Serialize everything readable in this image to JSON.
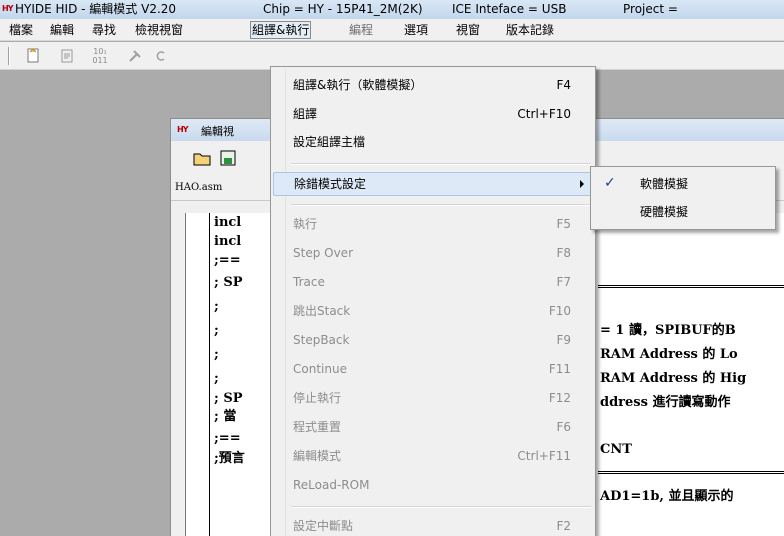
{
  "titlebar": {
    "app": "HYIDE HID - 編輯模式 V2.20",
    "chip": "Chip = HY - 15P41_2M(2K)",
    "ice": "ICE Inteface = USB",
    "project": "Project ="
  },
  "menubar": {
    "items": [
      "檔案",
      "編輯",
      "尋找",
      "檢視視窗",
      "組譯&執行",
      "編程",
      "選項",
      "視窗",
      "版本記錄"
    ]
  },
  "mdi": {
    "title": "編輯視",
    "tab": "HAO.asm",
    "code_left": [
      "incl",
      "incl",
      ";==",
      "; SP",
      ";",
      ";",
      ";",
      ";",
      "; SP",
      "; 當",
      ";==",
      ";預言"
    ],
    "code_right": [
      "= 1 讀，SPIBUF的B",
      "RAM Address 的 Lo",
      "RAM Address 的 Hig",
      "ddress 進行讀寫動作",
      "CNT",
      "AD1=1b, 並且顯示的"
    ]
  },
  "menu": {
    "items": [
      {
        "label": "組譯&執行（軟體模擬）",
        "shortcut": "F4",
        "disabled": false
      },
      {
        "label": "組譯",
        "shortcut": "Ctrl+F10",
        "disabled": false
      },
      {
        "label": "設定組譯主檔",
        "shortcut": "",
        "disabled": false
      },
      {
        "label": "除錯模式設定",
        "shortcut": "",
        "disabled": false,
        "submenu": true,
        "highlighted": true
      },
      {
        "label": "執行",
        "shortcut": "F5",
        "disabled": true
      },
      {
        "label": "Step Over",
        "shortcut": "F8",
        "disabled": true
      },
      {
        "label": "Trace",
        "shortcut": "F7",
        "disabled": true
      },
      {
        "label": "跳出Stack",
        "shortcut": "F10",
        "disabled": true
      },
      {
        "label": "StepBack",
        "shortcut": "F9",
        "disabled": true
      },
      {
        "label": "Continue",
        "shortcut": "F11",
        "disabled": true
      },
      {
        "label": "停止執行",
        "shortcut": "F12",
        "disabled": true
      },
      {
        "label": "程式重置",
        "shortcut": "F6",
        "disabled": true
      },
      {
        "label": "編輯模式",
        "shortcut": "Ctrl+F11",
        "disabled": true
      },
      {
        "label": "ReLoad-ROM",
        "shortcut": "",
        "disabled": true
      },
      {
        "label": "設定中斷點",
        "shortcut": "F2",
        "disabled": true
      }
    ]
  },
  "submenu": {
    "items": [
      {
        "label": "軟體模擬",
        "checked": true
      },
      {
        "label": "硬體模擬",
        "checked": false
      }
    ]
  },
  "icons": {
    "app_logo": "HY",
    "toolbar": [
      "new-file-icon",
      "align-icon",
      "binary-icon",
      "tools-icon"
    ]
  }
}
